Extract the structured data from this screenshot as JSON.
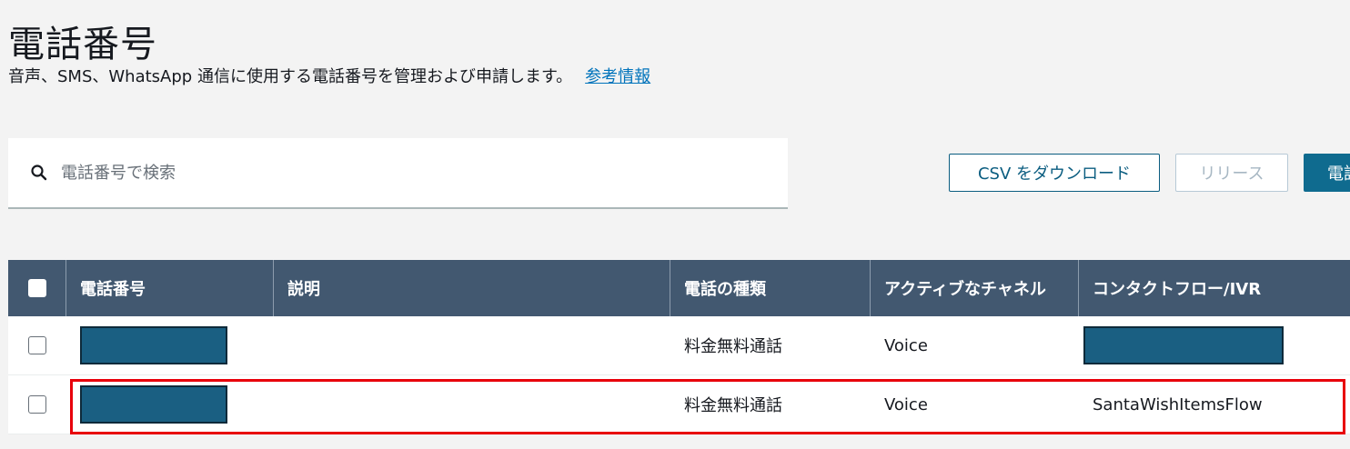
{
  "header": {
    "title": "電話番号",
    "description": "音声、SMS、WhatsApp 通信に使用する電話番号を管理および申請します。",
    "info_link": "参考情報"
  },
  "search": {
    "placeholder": "電話番号で検索"
  },
  "toolbar": {
    "csv_label": "CSV をダウンロード",
    "release_label": "リリース",
    "primary_label": "電話番号を申請"
  },
  "table": {
    "columns": [
      "電話番号",
      "説明",
      "電話の種類",
      "アクティブなチャネル",
      "コンタクトフロー/IVR"
    ],
    "rows": [
      {
        "phone": "",
        "description": "",
        "type": "料金無料通話",
        "channel": "Voice",
        "flow": ""
      },
      {
        "phone": "",
        "description": "",
        "type": "料金無料通話",
        "channel": "Voice",
        "flow": "SantaWishItemsFlow"
      }
    ]
  },
  "colors": {
    "header_bg": "#425870",
    "link": "#0073bb",
    "primary": "#0f6b8f",
    "highlight": "#e8000b",
    "redaction": "#1a5f82"
  }
}
